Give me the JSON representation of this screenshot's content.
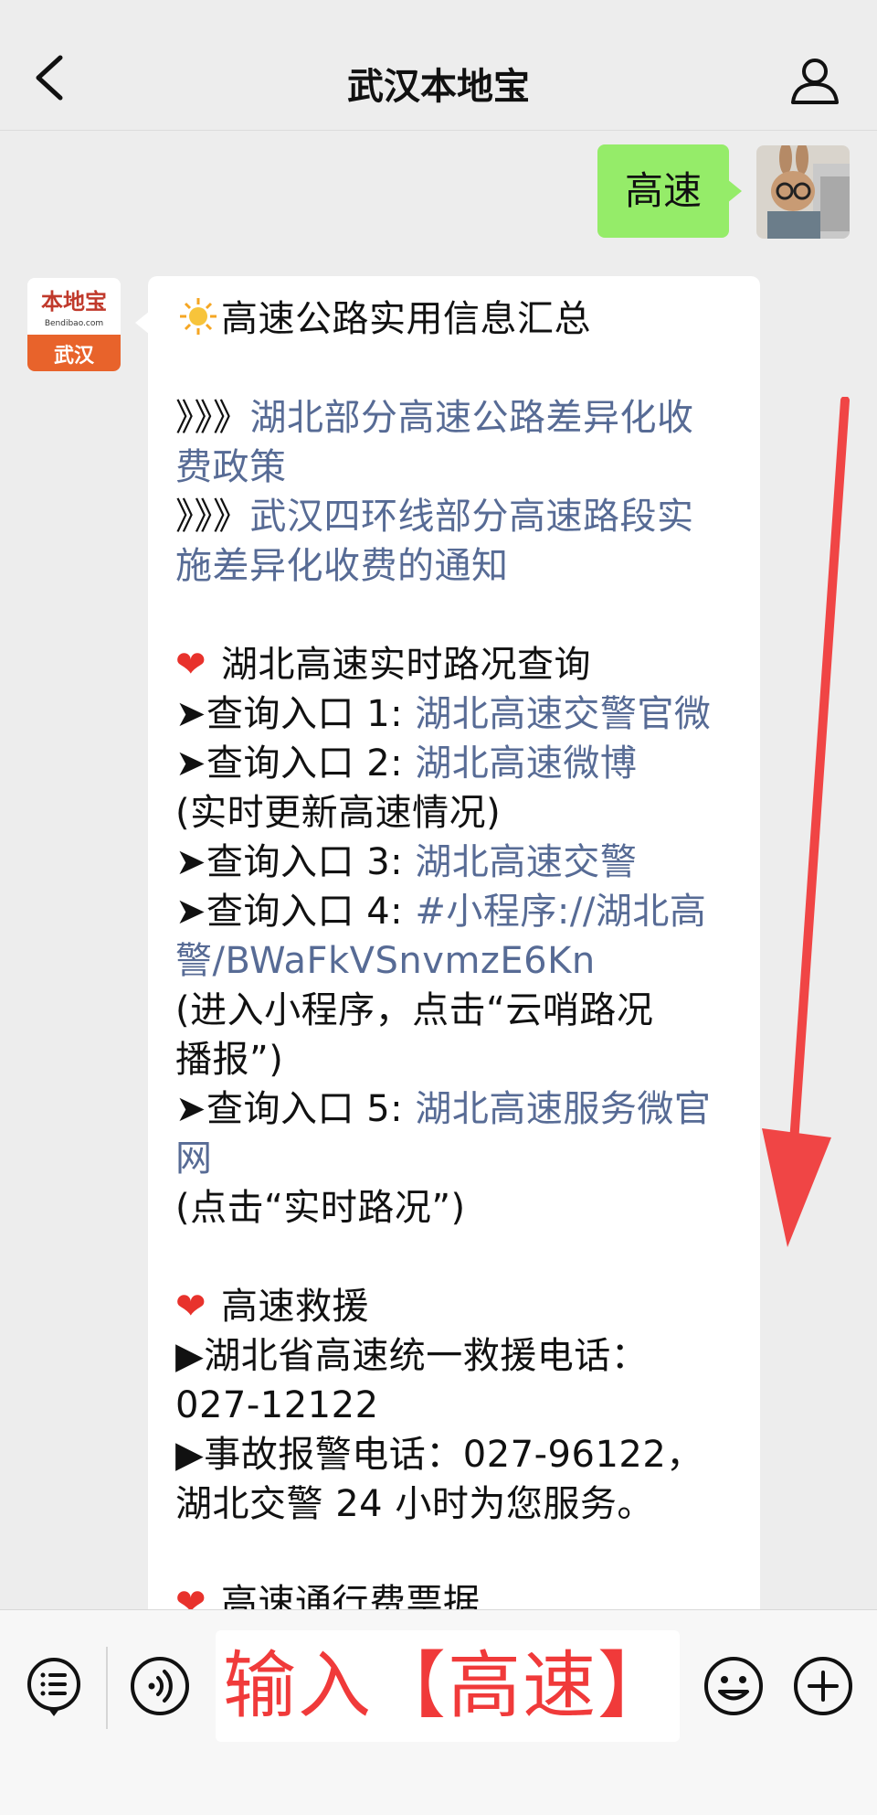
{
  "header": {
    "title": "武汉本地宝",
    "back_icon": "chevron-left-icon",
    "profile_icon": "person-icon"
  },
  "chat": {
    "user_message": "高速",
    "bot_avatar": {
      "brand_top": "本地宝",
      "brand_site": "Bendibao.com",
      "brand_city": "武汉"
    },
    "bot_message": {
      "line01": "高速公路实用信息汇总",
      "line02_prefix": "》》》",
      "line02_link": "湖北部分高速公路差异化收",
      "line03_link": "费政策",
      "line04_prefix": "》》》",
      "line04_link": "武汉四环线部分高速路段实",
      "line05_link": "施差异化收费的通知",
      "line06": "湖北高速实时路况查询",
      "line07_prefix": "➤查询入口 1: ",
      "line07_link": "湖北高速交警官微",
      "line08_prefix": "➤查询入口 2: ",
      "line08_link": "湖北高速微博",
      "line09": "(实时更新高速情况)",
      "line10_prefix": "➤查询入口 3: ",
      "line10_link": "湖北高速交警",
      "line11_prefix": "➤查询入口 4: ",
      "line11_link": "#小程序://湖北高",
      "line12_link": "警/BWaFkVSnvmzE6Kn",
      "line13": "(进入小程序，点击“云哨路况",
      "line14": "播报”)",
      "line15_prefix": "➤查询入口 5: ",
      "line15_link": "湖北高速服务微官",
      "line16_link": "网",
      "line17": "(点击“实时路况”)",
      "line18": "高速救援",
      "line19": "▶湖北省高速统一救援电话：",
      "line20": "027-12122",
      "line21": "▶事故报警电话：027-96122，",
      "line22": "湖北交警 24 小时为您服务。",
      "line23": "高速通行费票据"
    }
  },
  "toolbar": {
    "input_text": "输入【高速】",
    "icons": [
      "menu-icon",
      "voice-icon",
      "emoji-icon",
      "plus-icon"
    ]
  },
  "colors": {
    "link": "#576b95",
    "user_bubble": "#95ec69",
    "annotation_red": "#f03a3a",
    "brand_orange": "#e8632b"
  }
}
